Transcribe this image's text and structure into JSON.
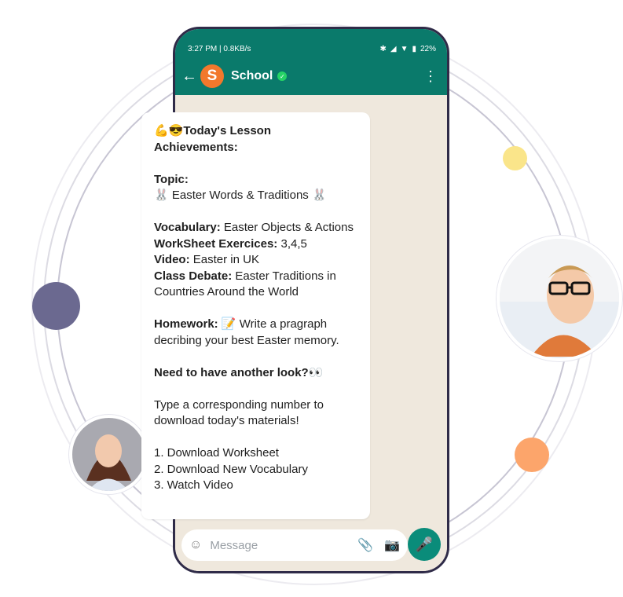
{
  "status_bar": {
    "time": "3:27 PM | 0.8KB/s",
    "battery": "22%",
    "icons": [
      "vibrate-icon",
      "alarm-icon",
      "bluetooth-icon",
      "signal-icon",
      "wifi-icon",
      "battery-icon"
    ]
  },
  "chat": {
    "name": "School",
    "avatar_letter": "S",
    "verified": true,
    "accent": "#0a7a6b"
  },
  "message": {
    "title_emoji": "💪😎",
    "title": "Today's Lesson Achievements:",
    "topic_label": "Topic:",
    "topic_value": "🐰 Easter Words & Traditions 🐰",
    "vocab_label": "Vocabulary:",
    "vocab_value": "Easter Objects & Actions",
    "worksheet_label": "WorkSheet Exercices:",
    "worksheet_value": "3,4,5",
    "video_label": "Video:",
    "video_value": "Easter in UK",
    "debate_label": "Class Debate:",
    "debate_value": "Easter Traditions in Countries Around the World",
    "homework_label": "Homework:",
    "homework_value": "📝 Write a pragraph decribing your best Easter memory.",
    "lookagain": "Need to have another look?👀",
    "instructions": "Type a corresponding number to download today's materials!",
    "options": [
      "1. Download Worksheet",
      "2. Download New Vocabulary",
      "3. Watch Video"
    ]
  },
  "input": {
    "placeholder": "Message"
  },
  "colors": {
    "header": "#0a7a6b",
    "ring_dark": "#6b6990",
    "dot_yellow": "#fae58a",
    "dot_orange": "#fca56b"
  }
}
